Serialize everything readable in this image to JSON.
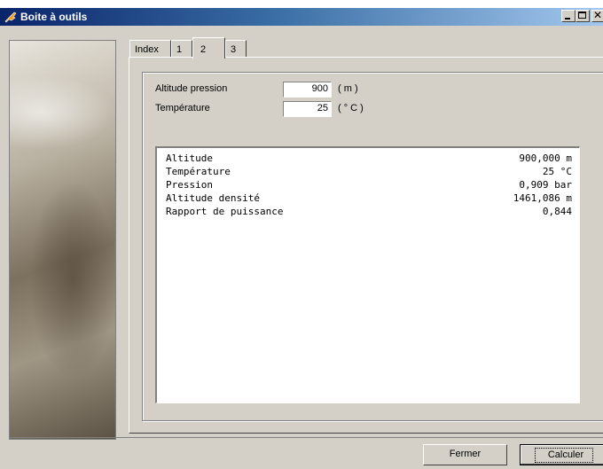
{
  "window": {
    "title": "Boite à outils"
  },
  "tabs": [
    {
      "label": "Index"
    },
    {
      "label": "1"
    },
    {
      "label": "2"
    },
    {
      "label": "3"
    }
  ],
  "active_tab": "2",
  "form": {
    "altitude": {
      "label": "Altitude pression",
      "value": "900",
      "unit": "( m )"
    },
    "temperature": {
      "label": "Température",
      "value": "25",
      "unit": "( ° C )"
    }
  },
  "results": [
    {
      "name": "Altitude",
      "value": "900,000 m"
    },
    {
      "name": "Température",
      "value": "25 °C"
    },
    {
      "name": "Pression",
      "value": "0,909 bar"
    },
    {
      "name": "Altitude densité",
      "value": "1461,086 m"
    },
    {
      "name": "Rapport de puissance",
      "value": "0,844"
    }
  ],
  "buttons": {
    "close_label": "Fermer",
    "compute_label": "Calculer"
  },
  "colors": {
    "titlebar_start": "#0a246a",
    "titlebar_end": "#a6caf0",
    "face": "#d4d0c8"
  }
}
